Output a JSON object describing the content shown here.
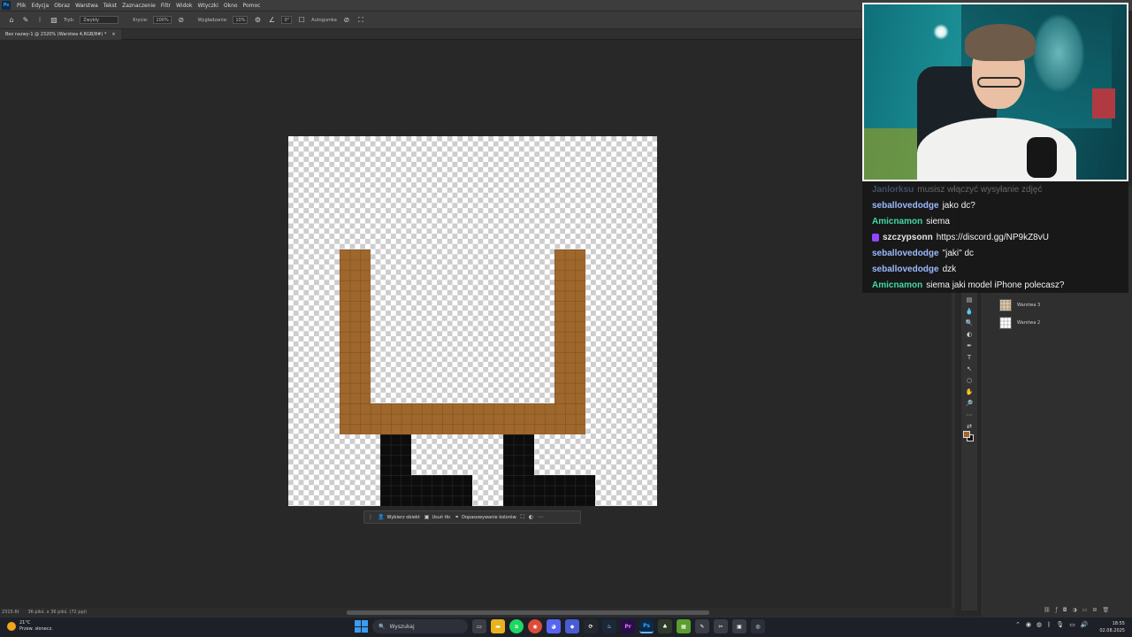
{
  "menu": {
    "items": [
      "Plik",
      "Edycja",
      "Obraz",
      "Warstwa",
      "Tekst",
      "Zaznaczenie",
      "Filtr",
      "Widok",
      "Wtyczki",
      "Okno",
      "Pomoc"
    ]
  },
  "options": {
    "mode_label": "Tryb:",
    "mode_value": "Zwykły",
    "opacity_label": "Krycie:",
    "opacity_value": "100%",
    "smoothing_label": "Wygładzanie:",
    "smoothing_value": "10%",
    "angle_value": "0°",
    "autoerase_label": "Autogumka"
  },
  "document": {
    "tab_title": "Bez nazwy-1 @ 2320% (Warstwa 4,RGB/8#) *",
    "tab_close": "×"
  },
  "context_bar": {
    "select_subject": "Wybierz obiekt",
    "remove_bg": "Usuń tło",
    "color_match": "Dopasowywanie kolorów"
  },
  "status": {
    "zoom": "2315.6t",
    "size": "36 pikś. x 36 pikś. (72 ppi)"
  },
  "colors": {
    "foreground": "#9f672c",
    "background": "#111111",
    "brown_pixels": "#9f672c",
    "black_pixels": "#0c0c0c"
  },
  "layers": [
    {
      "name": "Warstwa 3"
    },
    {
      "name": "Warstwa 2"
    }
  ],
  "chat": {
    "messages": [
      {
        "user": "Janlorksu",
        "text": "musisz włączyć wysyłanie zdjęć",
        "color": "#8fb4ff",
        "faded": true
      },
      {
        "user": "seballovedodge",
        "text": "jako dc?",
        "color": "#9bb9ff"
      },
      {
        "user": "Amicnamon",
        "text": "siema",
        "color": "#42d7a5"
      },
      {
        "user": "szczypsonn",
        "text": "https://discord.gg/NP9kZ8vU",
        "color": "#e6e6e6",
        "badge": true
      },
      {
        "user": "seballovedodge",
        "text": "\"jaki\" dc",
        "color": "#9bb9ff"
      },
      {
        "user": "seballovedodge",
        "text": "dzk",
        "color": "#9bb9ff"
      },
      {
        "user": "Amicnamon",
        "text": "siema jaki model iPhone polecasz?",
        "color": "#42d7a5"
      }
    ]
  },
  "taskbar": {
    "weather_temp": "21°C",
    "weather_desc": "Przew. słonecz.",
    "search_placeholder": "Wyszukaj",
    "time": "18:55",
    "date": "02.08.2025"
  }
}
